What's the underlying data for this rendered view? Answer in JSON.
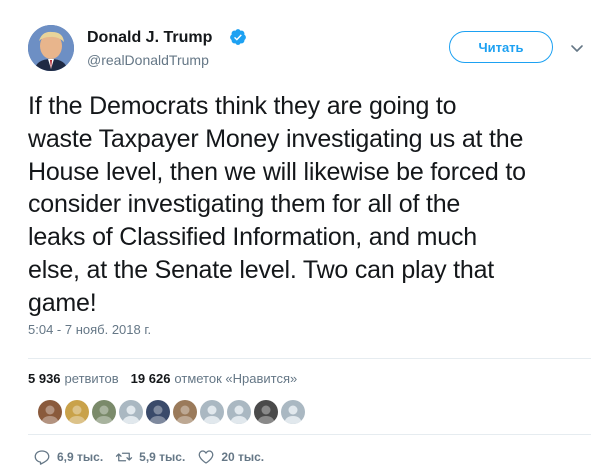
{
  "author": {
    "display_name": "Donald J. Trump",
    "handle": "@realDonaldTrump",
    "verified": true
  },
  "follow_button": {
    "label": "Читать"
  },
  "tweet": {
    "text": "If the Democrats think they are going to\nwaste Taxpayer Money investigating us at the\nHouse level, then we will likewise be forced to\nconsider investigating them for all of the\nleaks of Classified Information, and much\nelse, at the Senate level. Two can play that\ngame!",
    "timestamp": "5:04 - 7 нояб. 2018 г."
  },
  "stats": {
    "retweets_count": "5 936",
    "retweets_label": "ретвитов",
    "likes_count": "19 626",
    "likes_label": "отметок «Нравится»"
  },
  "liker_avatars": [
    {
      "name": "liker-avatar-1",
      "color": "#8a5a3c"
    },
    {
      "name": "liker-avatar-2",
      "color": "#c9a24a"
    },
    {
      "name": "liker-avatar-3",
      "color": "#7a8a6a"
    },
    {
      "name": "liker-avatar-4",
      "color": "#aab8c2"
    },
    {
      "name": "liker-avatar-5",
      "color": "#3a4a6a"
    },
    {
      "name": "liker-avatar-6",
      "color": "#9a7a5a"
    },
    {
      "name": "liker-avatar-7",
      "color": "#aab8c2"
    },
    {
      "name": "liker-avatar-8",
      "color": "#aab8c2"
    },
    {
      "name": "liker-avatar-9",
      "color": "#4a4a4a"
    },
    {
      "name": "liker-avatar-10",
      "color": "#aab8c2"
    }
  ],
  "actions": {
    "reply_count": "6,9 тыс.",
    "retweet_count": "5,9 тыс.",
    "like_count": "20 тыс."
  },
  "colors": {
    "accent": "#1da1f2",
    "text": "#14171a",
    "muted": "#657786",
    "divider": "#e6ecf0"
  }
}
